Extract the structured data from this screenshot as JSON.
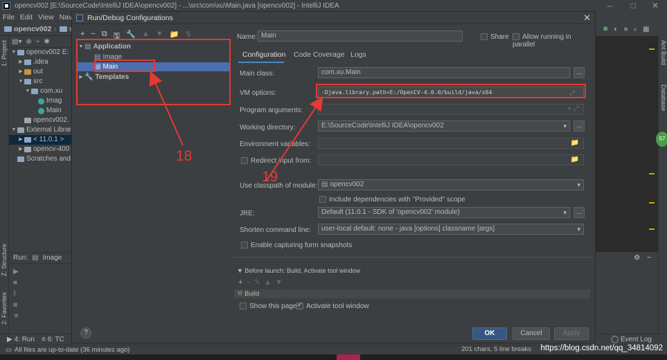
{
  "window": {
    "title": "opencv002 [E:\\SourceCode\\IntelliJ IDEA\\opencv002] - ...\\src\\com\\xu\\Main.java [opencv002] - IntelliJ IDEA",
    "min": "–",
    "max": "□",
    "close": "✕"
  },
  "menu": {
    "items": [
      "File",
      "Edit",
      "View",
      "Navig"
    ]
  },
  "nav": {
    "project": "opencv002",
    "src": "src"
  },
  "project_panel": {
    "tab_label": "1: Project",
    "tree": [
      {
        "label": "opencv002 E:",
        "indent": 0,
        "twisty": "▼",
        "icon": "blue"
      },
      {
        "label": ".idea",
        "indent": 1,
        "twisty": "▶",
        "icon": "blue"
      },
      {
        "label": "out",
        "indent": 1,
        "twisty": "▶",
        "icon": "orange"
      },
      {
        "label": "src",
        "indent": 1,
        "twisty": "▼",
        "icon": "blue"
      },
      {
        "label": "com.xu",
        "indent": 2,
        "twisty": "▼",
        "icon": "blue"
      },
      {
        "label": "Imag",
        "indent": 3,
        "twisty": "",
        "icon": "green-c"
      },
      {
        "label": "Main",
        "indent": 3,
        "twisty": "",
        "icon": "green-c"
      },
      {
        "label": "opencv002.",
        "indent": 1,
        "twisty": "",
        "icon": "lib"
      },
      {
        "label": "External Librar",
        "indent": 0,
        "twisty": "▼",
        "icon": "lib"
      },
      {
        "label": "< 11.0.1 >",
        "indent": 1,
        "twisty": "▶",
        "icon": "blue",
        "selected": true
      },
      {
        "label": "opencv-400",
        "indent": 1,
        "twisty": "▶",
        "icon": "lib"
      },
      {
        "label": "Scratches and",
        "indent": 0,
        "twisty": "",
        "icon": "blue"
      }
    ]
  },
  "left_strip": {
    "structure": "Z: Structure",
    "favorites": "2: Favorites"
  },
  "right_strip": {
    "ant": "Ant Build",
    "database": "Database",
    "badge": "57"
  },
  "run_panel": {
    "label": "Run:",
    "tab": "Image"
  },
  "dialog": {
    "title": "Run/Debug Configurations",
    "close": "✕",
    "toolbar": {
      "add": "+",
      "remove": "−",
      "copy": "⧉",
      "save": "🖫",
      "wrench": "🔧",
      "up": "▲",
      "down": "▼",
      "folder": "📁",
      "sort": "⇅"
    },
    "tree": {
      "application": "Application",
      "image": "Image",
      "main": "Main",
      "templates": "Templates"
    },
    "name_label": "Name:",
    "name_value": "Main",
    "share_label": "Share",
    "parallel_label": "Allow running in parallel",
    "tabs": {
      "configuration": "Configuration",
      "coverage": "Code Coverage",
      "logs": "Logs"
    },
    "main_class_label": "Main class:",
    "main_class_value": "com.xu.Main",
    "vm_label": "VM options:",
    "vm_value": "-Djava.library.path=E:/OpenCV-4.0.0/build/java/x64",
    "prog_args_label": "Program arguments:",
    "workdir_label": "Working directory:",
    "workdir_value": "E:\\SourceCode\\IntelliJ IDEA\\opencv002",
    "env_label": "Environment variables:",
    "redirect_label": "Redirect input from:",
    "classpath_label": "Use classpath of module:",
    "classpath_value": "opencv002",
    "provided_label": "Include dependencies with \"Provided\" scope",
    "jre_label": "JRE:",
    "jre_value": "Default (11.0.1 - SDK of 'opencv002' module)",
    "shorten_label": "Shorten command line:",
    "shorten_value": "user-local default: none - java [options] classname [args]",
    "snapshots_label": "Enable capturing form snapshots",
    "before_launch": "Before launch: Build, Activate tool window",
    "build_item": "Build",
    "show_page": "Show this page",
    "activate_tool": "Activate tool window",
    "help": "?",
    "ok": "OK",
    "cancel": "Cancel",
    "apply": "Apply",
    "more": "...",
    "folder": "📁"
  },
  "annotations": {
    "n18": "18",
    "n19": "19",
    "color": "#e53935"
  },
  "bottom_tabs": {
    "run": "4: Run",
    "todo": "6: TC",
    "event_log": "Event Log"
  },
  "status": {
    "left": "All files are up-to-date (36 minutes ago)",
    "right": "201 chars, 5 line breaks",
    "watermark": "https://blog.csdn.net/qq_34814092"
  }
}
